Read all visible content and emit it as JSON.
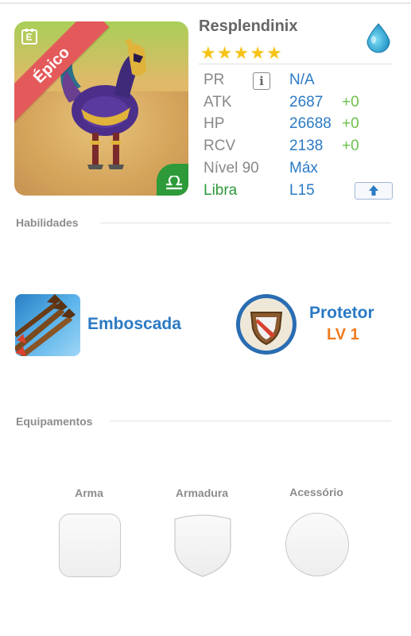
{
  "monster": {
    "name": "Resplendinix",
    "rarity": "Épico",
    "stars": 5,
    "element_icon": "water-drop-icon",
    "zodiac_icon": "libra-symbol-icon"
  },
  "stats": [
    {
      "label": "PR",
      "value": "N/A",
      "bonus": ""
    },
    {
      "label": "ATK",
      "value": "2687",
      "bonus": "+0"
    },
    {
      "label": "HP",
      "value": "26688",
      "bonus": "+0"
    },
    {
      "label": "RCV",
      "value": "2138",
      "bonus": "+0"
    }
  ],
  "level": {
    "label": "Nível 90",
    "value": "Máx"
  },
  "sign": {
    "label": "Libra",
    "value": "L15"
  },
  "sections": {
    "skills": "Habilidades",
    "equipment": "Equipamentos"
  },
  "skills": {
    "active": {
      "name": "Emboscada",
      "icon": "arrows-skill-icon"
    },
    "leader": {
      "name": "Protetor",
      "level": "LV 1",
      "icon": "shield-skill-icon"
    }
  },
  "equipment": {
    "weapon_label": "Arma",
    "armor_label": "Armadura",
    "accessory_label": "Acessório"
  },
  "colors": {
    "blue_value": "#2b7ac4",
    "green_bonus": "#6cc24a",
    "orange_level": "#f07b1f",
    "libra_green": "#2e9a3a",
    "rarity_ribbon": "#e45a5a"
  }
}
